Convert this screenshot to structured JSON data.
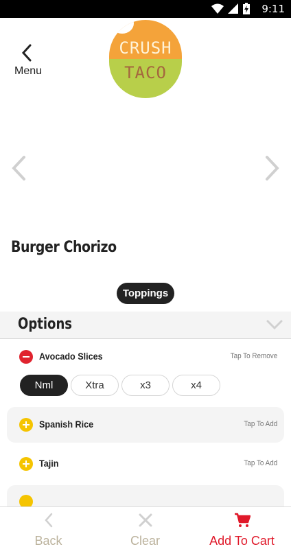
{
  "status_bar": {
    "time": "9:11"
  },
  "header": {
    "back_label": "Menu",
    "logo_top": "CRUSH",
    "logo_bottom": "TACO"
  },
  "product": {
    "title": "Burger Chorizo"
  },
  "toppings_button": "Toppings",
  "options": {
    "title": "Options",
    "items": [
      {
        "label": "Avocado Slices",
        "action": "Tap To Remove",
        "state": "selected"
      },
      {
        "label": "Spanish Rice",
        "action": "Tap To Add",
        "state": "unselected"
      },
      {
        "label": "Tajin",
        "action": "Tap To Add",
        "state": "unselected"
      }
    ],
    "quantities": [
      "Nml",
      "Xtra",
      "x3",
      "x4"
    ],
    "selected_quantity": "Nml"
  },
  "bottom_bar": {
    "back": "Back",
    "clear": "Clear",
    "add_to_cart": "Add To Cart"
  },
  "colors": {
    "accent_red": "#e0192a",
    "add_yellow": "#f5c400",
    "logo_orange": "#f4a33a",
    "logo_green": "#b8cf4a"
  }
}
